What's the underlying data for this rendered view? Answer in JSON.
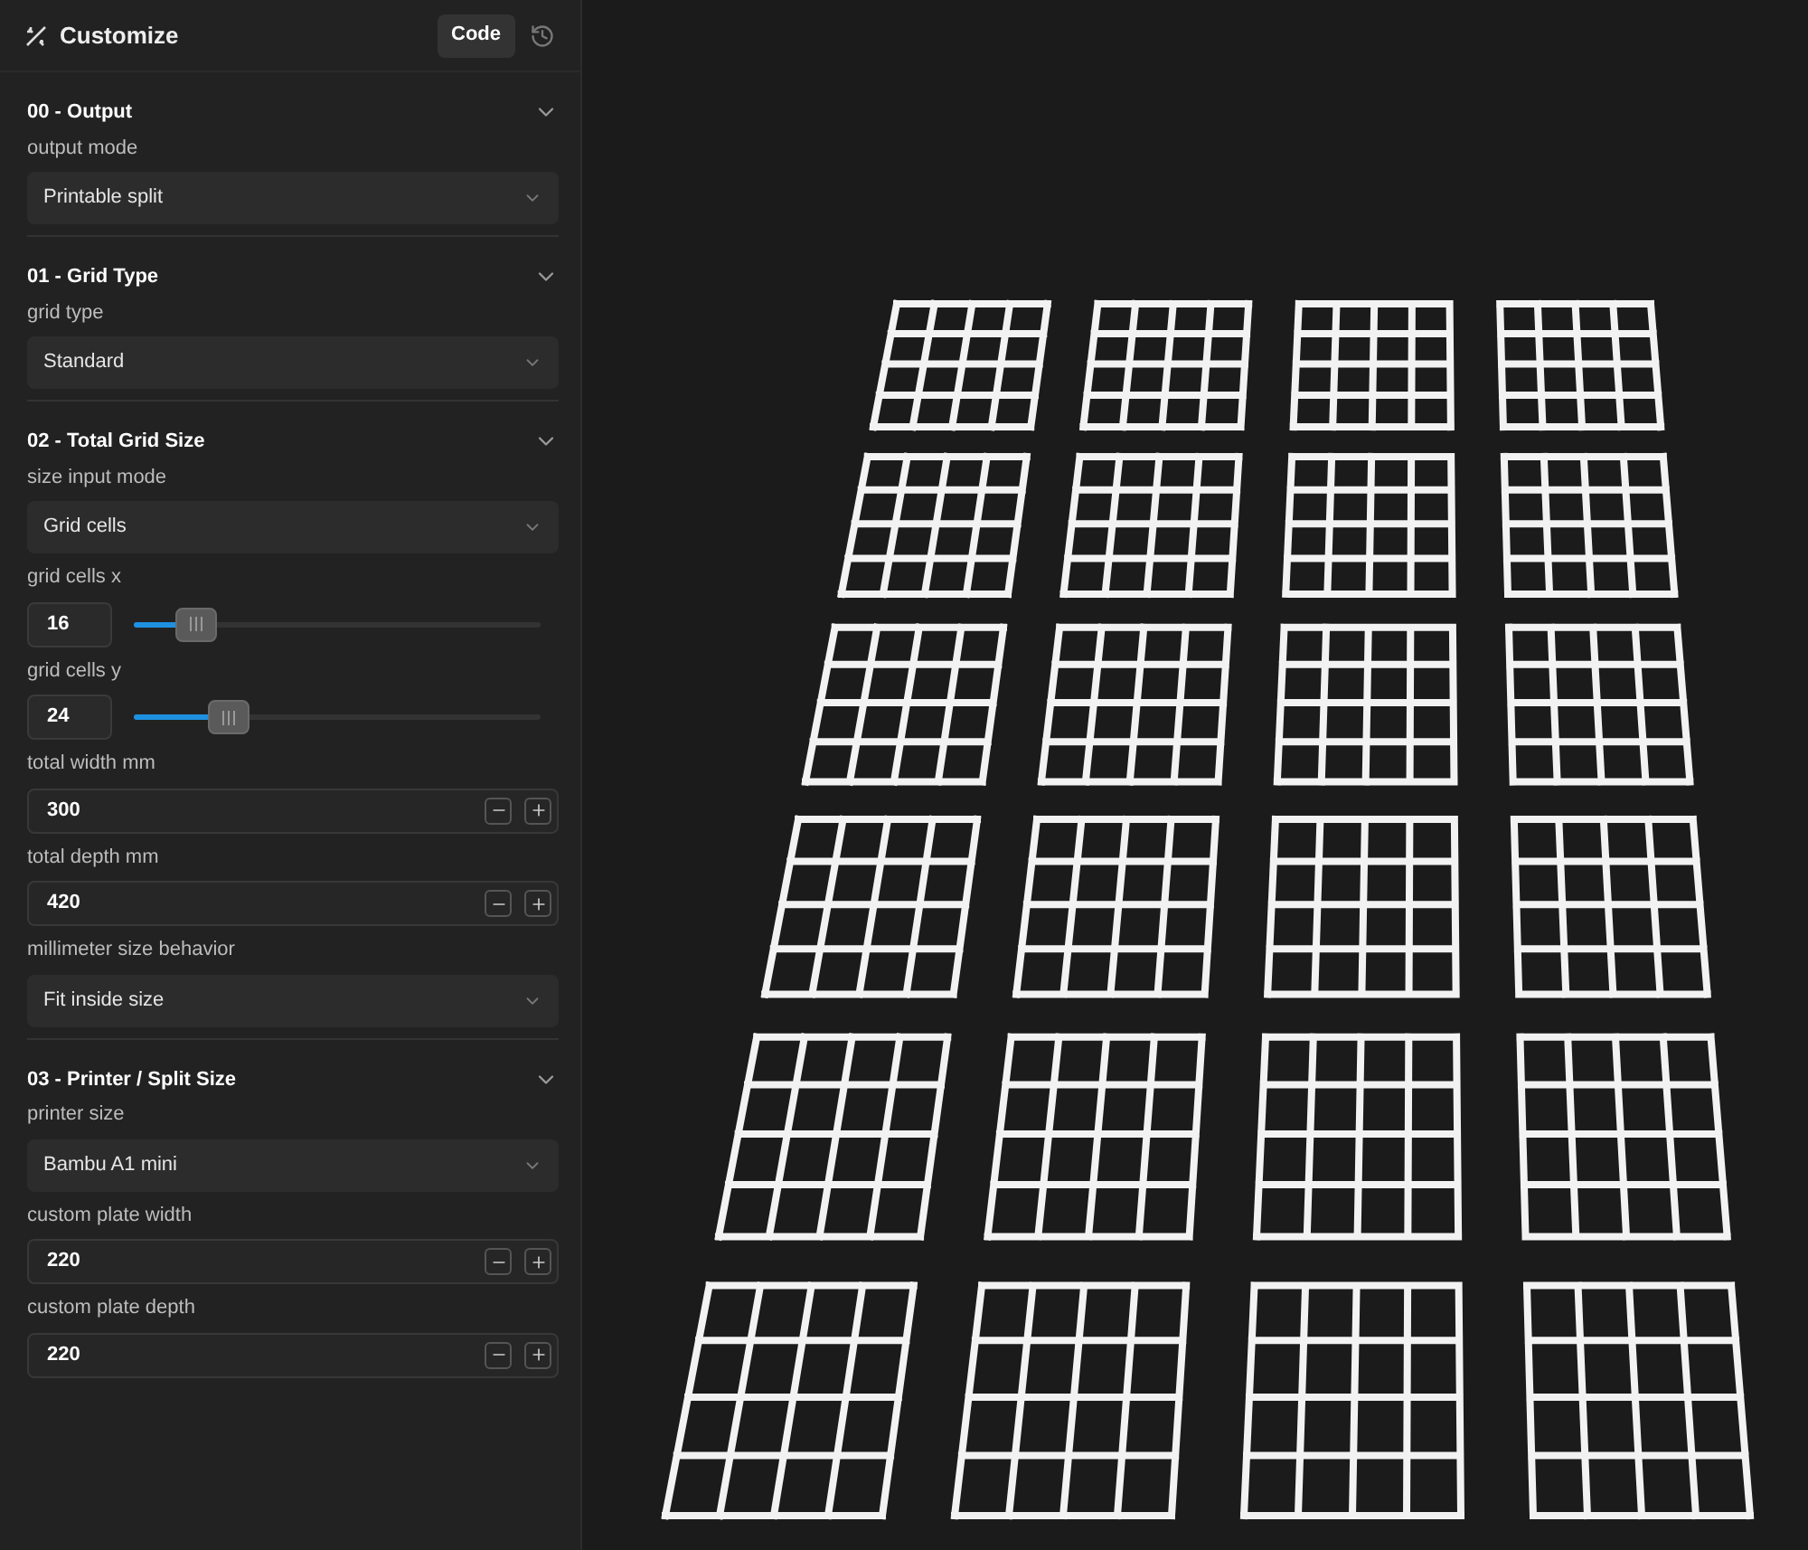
{
  "header": {
    "title": "Customize",
    "code_button": "Code"
  },
  "sections": [
    {
      "title": "00 - Output",
      "expanded": true,
      "fields": [
        {
          "kind": "select",
          "label": "output mode",
          "value": "Printable split"
        }
      ]
    },
    {
      "title": "01 - Grid Type",
      "expanded": true,
      "fields": [
        {
          "kind": "select",
          "label": "grid type",
          "value": "Standard"
        }
      ]
    },
    {
      "title": "02 - Total Grid Size",
      "expanded": true,
      "fields": [
        {
          "kind": "select",
          "label": "size input mode",
          "value": "Grid cells"
        },
        {
          "kind": "slider",
          "label": "grid cells x",
          "value": "16",
          "level": 0.15
        },
        {
          "kind": "slider",
          "label": "grid cells y",
          "value": "24",
          "level": 0.23
        },
        {
          "kind": "number",
          "label": "total width mm",
          "value": "300"
        },
        {
          "kind": "number",
          "label": "total depth mm",
          "value": "420"
        },
        {
          "kind": "select",
          "label": "millimeter size behavior",
          "value": "Fit inside size"
        }
      ]
    },
    {
      "title": "03 - Printer / Split Size",
      "expanded": true,
      "fields": [
        {
          "kind": "select",
          "label": "printer size",
          "value": "Bambu A1 mini"
        },
        {
          "kind": "number",
          "label": "custom plate width",
          "value": "220"
        },
        {
          "kind": "number",
          "label": "custom plate depth",
          "value": "220"
        }
      ]
    }
  ]
}
